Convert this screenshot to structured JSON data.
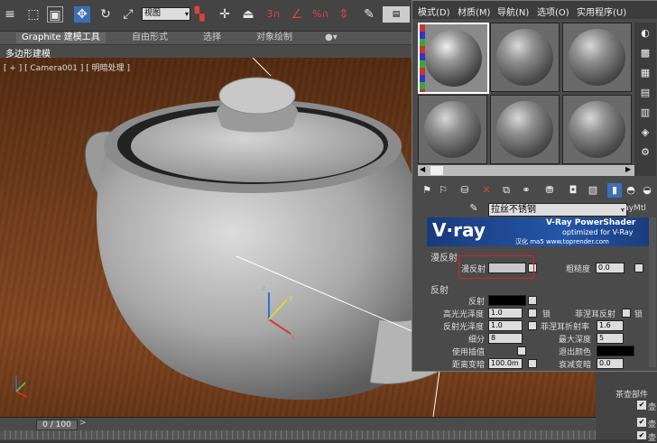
{
  "toolbar": {
    "view_select": "视图",
    "icons": [
      "edit-named-selection-icon",
      "select-region-icon",
      "select-object-icon",
      "move-icon",
      "rotate-icon",
      "scale-icon",
      "view-select",
      "mirror-icon",
      "align-icon",
      "snap-3d-icon",
      "angle-snap-icon",
      "percent-snap-icon",
      "spinner-snap-icon",
      "named-selection-icon",
      "layer-icon"
    ]
  },
  "ribbon": {
    "tabs": [
      "Graphite 建模工具",
      "自由形式",
      "选择",
      "对象绘制"
    ],
    "sub_tab": "多边形建模"
  },
  "viewport": {
    "label": "[ + ] [ Camera001 ] [ 明暗处理 ]"
  },
  "timeline": {
    "frame": "0 / 100"
  },
  "material_editor": {
    "menu": [
      "模式(D)",
      "材质(M)",
      "导航(N)",
      "选项(O)",
      "实用程序(U)"
    ],
    "material_name": "拉丝不锈钢",
    "material_type": "VRayMtl",
    "banner_title": "V-Ray PowerShader",
    "banner_sub": "optimized for V-Ray",
    "banner_credit": "汉化 ma5 www.toprender.com",
    "banner_logo": "V·ray",
    "diffuse_section": "漫反射",
    "diffuse_label": "漫反射",
    "roughness_label": "粗糙度",
    "roughness_value": "0.0",
    "reflect_section": "反射",
    "reflect_label": "反射",
    "hilight_gloss_label": "高光光泽度",
    "hilight_gloss_value": "1.0",
    "lock_label": "锁",
    "fresnel_label": "菲涅耳反射",
    "refl_gloss_label": "反射光泽度",
    "refl_gloss_value": "1.0",
    "fresnel_ior_label": "菲涅耳折射率",
    "fresnel_ior_value": "1.6",
    "subdivs_label": "细分",
    "subdivs_value": "8",
    "max_depth_label": "最大深度",
    "max_depth_value": "5",
    "interp_label": "使用插值",
    "exit_color_label": "退出颜色",
    "dist_dim_label": "距离变暗",
    "dist_dim_value": "100.0m",
    "decay_label": "衰减变暗",
    "decay_value": "0.0"
  },
  "command_panel": {
    "group_label": "茶壶部件",
    "item1": "壶",
    "item2": "壶",
    "item3": "壶"
  },
  "colors": {
    "highlight_box": "#e02020",
    "banner": "#2456a8",
    "wood": "#7a4220"
  }
}
